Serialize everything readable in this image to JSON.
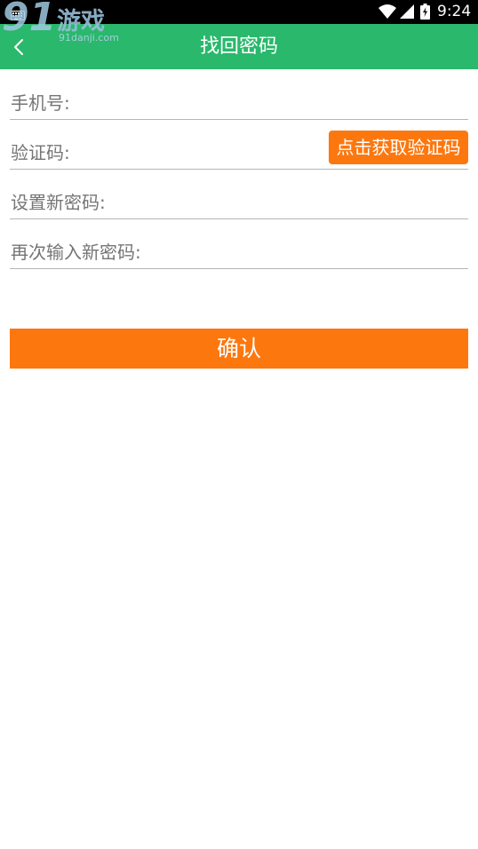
{
  "status_bar": {
    "time": "9:24",
    "icons": [
      "keyboard-icon",
      "wifi-icon",
      "cell-signal-icon",
      "battery-icon"
    ]
  },
  "watermark": {
    "number": "91",
    "text": "游戏",
    "url": "91danji.com"
  },
  "header": {
    "title": "找回密码",
    "back_icon": "chevron-left-icon",
    "background": "#2ab86c"
  },
  "form": {
    "phone_label": "手机号:",
    "code_label": "验证码:",
    "get_code_button": "点击获取验证码",
    "new_password_label": "设置新密码:",
    "repeat_password_label": "再次输入新密码:"
  },
  "confirm_button": "确认",
  "colors": {
    "accent": "#fd770f",
    "header": "#2ab86c",
    "label": "#757575",
    "divider": "#b5b5b5"
  }
}
